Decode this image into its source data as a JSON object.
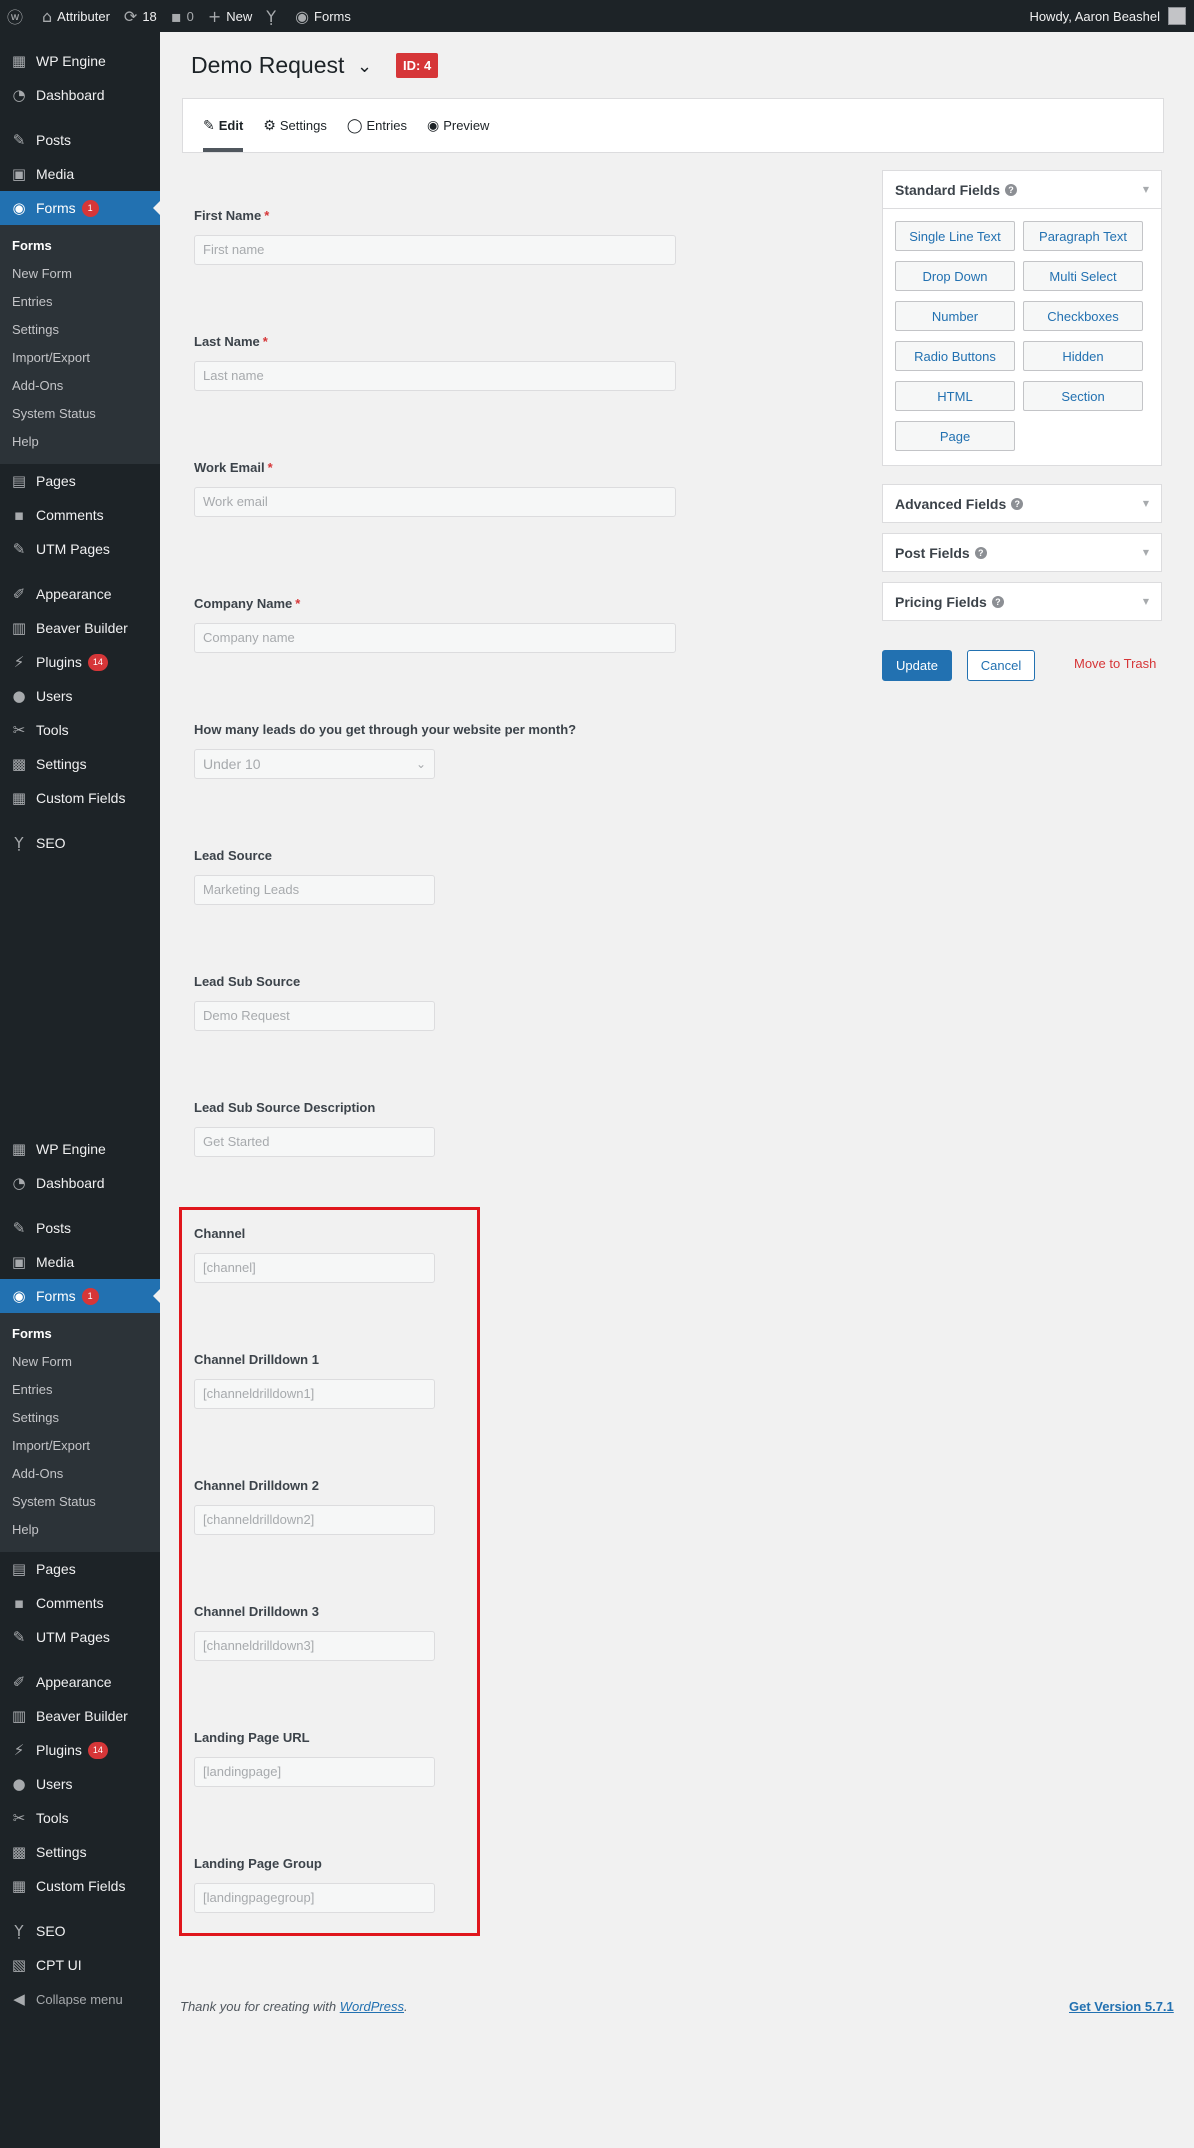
{
  "admin_bar": {
    "site_name": "Attributer",
    "updates_count": "18",
    "comments_count": "0",
    "new_label": "New",
    "forms_label": "Forms",
    "greeting": "Howdy, Aaron Beashel"
  },
  "sidebar": {
    "items": {
      "wp_engine": "WP Engine",
      "dashboard": "Dashboard",
      "posts": "Posts",
      "media": "Media",
      "forms": "Forms",
      "forms_badge": "1",
      "pages": "Pages",
      "comments": "Comments",
      "utm_pages": "UTM Pages",
      "appearance": "Appearance",
      "beaver_builder": "Beaver Builder",
      "plugins": "Plugins",
      "plugins_badge": "14",
      "users": "Users",
      "tools": "Tools",
      "settings": "Settings",
      "custom_fields": "Custom Fields",
      "seo": "SEO",
      "cpt_ui": "CPT UI",
      "collapse": "Collapse menu"
    },
    "forms_submenu": {
      "forms": "Forms",
      "new_form": "New Form",
      "entries": "Entries",
      "settings": "Settings",
      "import_export": "Import/Export",
      "add_ons": "Add-Ons",
      "system_status": "System Status",
      "help": "Help"
    }
  },
  "header": {
    "form_title": "Demo Request",
    "id_badge": "ID: 4"
  },
  "toolbar": {
    "edit": "Edit",
    "settings": "Settings",
    "entries": "Entries",
    "preview": "Preview"
  },
  "fields": {
    "first_name": {
      "label": "First Name",
      "placeholder": "First name",
      "required": "*"
    },
    "last_name": {
      "label": "Last Name",
      "placeholder": "Last name",
      "required": "*"
    },
    "work_email": {
      "label": "Work Email",
      "placeholder": "Work email",
      "required": "*"
    },
    "company_name": {
      "label": "Company Name",
      "placeholder": "Company name",
      "required": "*"
    },
    "leads": {
      "label": "How many leads do you get through your website per month?",
      "value": "Under 10"
    },
    "lead_source": {
      "label": "Lead Source",
      "value": "Marketing Leads"
    },
    "lead_sub_source": {
      "label": "Lead Sub Source",
      "value": "Demo Request"
    },
    "lead_sub_source_desc": {
      "label": "Lead Sub Source Description",
      "value": "Get Started"
    },
    "channel": {
      "label": "Channel",
      "value": "[channel]"
    },
    "channel_dd1": {
      "label": "Channel Drilldown 1",
      "value": "[channeldrilldown1]"
    },
    "channel_dd2": {
      "label": "Channel Drilldown 2",
      "value": "[channeldrilldown2]"
    },
    "channel_dd3": {
      "label": "Channel Drilldown 3",
      "value": "[channeldrilldown3]"
    },
    "landing_page_url": {
      "label": "Landing Page URL",
      "value": "[landingpage]"
    },
    "landing_page_group": {
      "label": "Landing Page Group",
      "value": "[landingpagegroup]"
    }
  },
  "panel": {
    "standard_fields": "Standard Fields",
    "buttons": {
      "single_line": "Single Line Text",
      "paragraph": "Paragraph Text",
      "drop_down": "Drop Down",
      "multi_select": "Multi Select",
      "number": "Number",
      "checkboxes": "Checkboxes",
      "radio": "Radio Buttons",
      "hidden": "Hidden",
      "html": "HTML",
      "section": "Section",
      "page": "Page"
    },
    "advanced_fields": "Advanced Fields",
    "post_fields": "Post Fields",
    "pricing_fields": "Pricing Fields"
  },
  "actions": {
    "update": "Update",
    "cancel": "Cancel",
    "trash": "Move to Trash"
  },
  "footer": {
    "thanks_prefix": "Thank you for creating with ",
    "wordpress_link": "WordPress",
    "thanks_suffix": ".",
    "version": "Get Version 5.7.1"
  },
  "colors": {
    "admin_dark": "#1d2327",
    "accent_blue": "#2271b1",
    "alert_red": "#d63638",
    "highlight_box": "#e0161c"
  }
}
